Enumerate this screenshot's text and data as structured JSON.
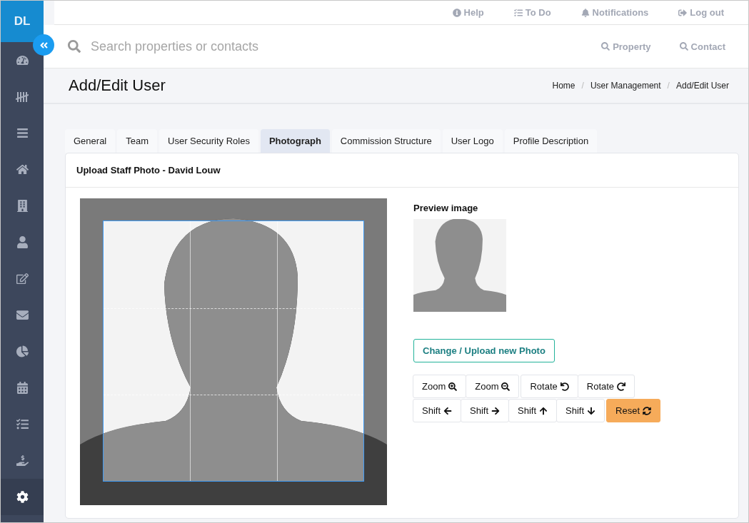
{
  "sidebar": {
    "initials": "DL",
    "items": [
      {
        "selected": false
      },
      {
        "selected": false
      },
      {
        "selected": false
      },
      {
        "selected": false
      },
      {
        "selected": false
      },
      {
        "selected": false
      },
      {
        "selected": false
      },
      {
        "selected": false
      },
      {
        "selected": false
      },
      {
        "selected": false
      },
      {
        "selected": false
      },
      {
        "selected": false
      },
      {
        "selected": true
      }
    ]
  },
  "top_links": [
    {
      "label": "Help",
      "kind": "help"
    },
    {
      "label": "To Do",
      "kind": "todo"
    },
    {
      "label": "Notifications",
      "kind": "bell"
    },
    {
      "label": "Log out",
      "kind": "logout"
    }
  ],
  "search": {
    "placeholder": "Search properties or contacts"
  },
  "search_links": [
    "Property",
    "Contact"
  ],
  "page_title": "Add/Edit User",
  "breadcrumbs": [
    "Home",
    "User Management",
    "Add/Edit User"
  ],
  "breadcrumb_separators": [
    "/",
    "/"
  ],
  "tabs": [
    {
      "label": "General",
      "selected": false
    },
    {
      "label": "Team",
      "selected": false
    },
    {
      "label": "User Security Roles",
      "selected": false
    },
    {
      "label": "Photograph",
      "selected": true
    },
    {
      "label": "Commission Structure",
      "selected": false
    },
    {
      "label": "User Logo",
      "selected": false
    },
    {
      "label": "Profile Description",
      "selected": false
    }
  ],
  "card_title": "Upload Staff Photo - David Louw",
  "preview_label": "Preview image",
  "upload_button": "Change / Upload new Photo",
  "toolbar_rows": [
    [
      [
        "Zoom",
        "Zoom"
      ],
      [
        "Rotate",
        "Rotate"
      ]
    ],
    [
      [
        "Shift",
        "Shift",
        "Shift",
        "Shift"
      ],
      [
        "Reset"
      ]
    ]
  ]
}
